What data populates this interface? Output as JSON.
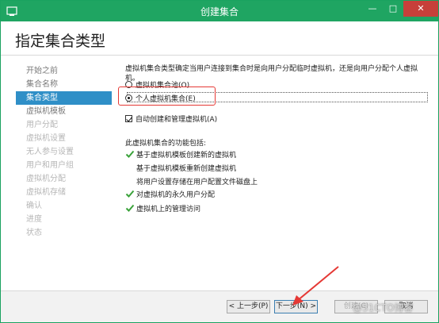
{
  "window": {
    "title": "创建集合"
  },
  "page": {
    "heading": "指定集合类型"
  },
  "nav": {
    "items": [
      {
        "label": "开始之前",
        "state": "normal"
      },
      {
        "label": "集合名称",
        "state": "normal"
      },
      {
        "label": "集合类型",
        "state": "active"
      },
      {
        "label": "虚拟机模板",
        "state": "normal"
      },
      {
        "label": "用户分配",
        "state": "disabled"
      },
      {
        "label": "虚拟机设置",
        "state": "disabled"
      },
      {
        "label": "无人参与设置",
        "state": "disabled"
      },
      {
        "label": "用户和用户组",
        "state": "disabled"
      },
      {
        "label": "虚拟机分配",
        "state": "disabled"
      },
      {
        "label": "虚拟机存储",
        "state": "disabled"
      },
      {
        "label": "确认",
        "state": "disabled"
      },
      {
        "label": "进度",
        "state": "disabled"
      },
      {
        "label": "状态",
        "state": "disabled"
      }
    ]
  },
  "content": {
    "description": "虚拟机集合类型确定当用户连接到集合时是向用户分配临时虚拟机，还是向用户分配个人虚拟机。",
    "options": [
      {
        "label": "虚拟机集合池(O)",
        "selected": false
      },
      {
        "label": "个人虚拟机集合(E)",
        "selected": true
      }
    ],
    "auto_manage": {
      "label": "自动创建和管理虚拟机(A)",
      "checked": true
    },
    "features_title": "此虚拟机集合的功能包括:",
    "features": [
      {
        "label": "基于虚拟机模板创建新的虚拟机",
        "supported": true
      },
      {
        "label": "基于虚拟机模板重新创建虚拟机",
        "supported": false
      },
      {
        "label": "将用户设置存储在用户配置文件磁盘上",
        "supported": false
      },
      {
        "label": "对虚拟机的永久用户分配",
        "supported": true
      },
      {
        "label": "虚拟机上的管理访问",
        "supported": true
      }
    ]
  },
  "buttons": {
    "back": "< 上一步(P)",
    "next": "下一步(N) >",
    "create": "创建(C)",
    "cancel": "取消"
  },
  "watermark": "@51CTO博客",
  "colors": {
    "titlebar": "#1fa562",
    "nav_active": "#2f8fc7",
    "annotation": "#e53935",
    "check": "#3aa23a"
  }
}
